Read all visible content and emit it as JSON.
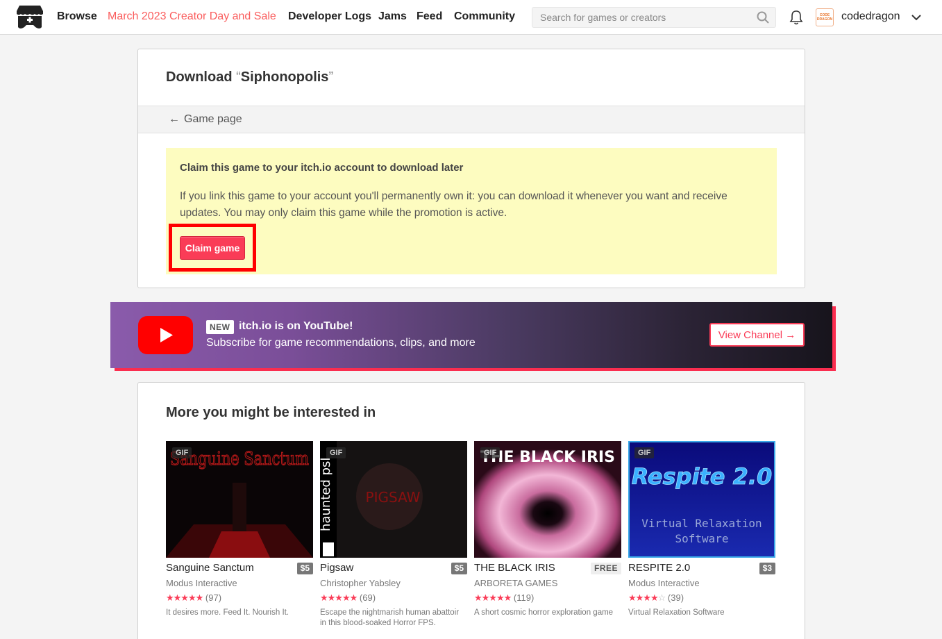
{
  "header": {
    "nav": [
      "Browse",
      "March 2023 Creator Day and Sale",
      "Developer Logs",
      "Jams",
      "Feed",
      "Community"
    ],
    "search_placeholder": "Search for games or creators",
    "username": "codedragon",
    "avatar_text": "CODE DRAGON",
    "accent_color": "#fa5c5c"
  },
  "card": {
    "title_prefix": "Download ",
    "open_quote": "“",
    "game_name": "Siphonopolis",
    "close_quote": "”",
    "back_arrow": "←",
    "back_label": "Game page",
    "claim_heading": "Claim this game to your itch.io account to download later",
    "claim_text": "If you link this game to your account you'll permanently own it: you can download it whenever you want and receive updates. You may only claim this game while the promotion is active.",
    "claim_button": "Claim game"
  },
  "banner": {
    "new_badge": "NEW",
    "title": "itch.io is on YouTube!",
    "subtitle": "Subscribe for game recommendations, clips, and more",
    "button": "View Channel →"
  },
  "recommendations": {
    "title": "More you might be interested in",
    "gif_badge": "GIF",
    "games": [
      {
        "title": "Sanguine Sanctum",
        "price": "$5",
        "author": "Modus Interactive",
        "rating": 4.5,
        "stars": "★★★★★",
        "empty_stars": "",
        "reviews": "(97)",
        "description": "It desires more. Feed It. Nourish It.",
        "thumb_text": "Sanguine Sanctum"
      },
      {
        "title": "Pigsaw",
        "price": "$5",
        "author": "Christopher Yabsley",
        "rating": 4.5,
        "stars": "★★★★★",
        "empty_stars": "",
        "reviews": "(69)",
        "description": "Escape the nightmarish human abattoir in this blood-soaked Horror FPS.",
        "thumb_text": "PIGSAW",
        "thumb_side_text": "haunted psl"
      },
      {
        "title": "THE BLACK IRIS",
        "price": "FREE",
        "author": "ARBORETA GAMES",
        "rating": 4.5,
        "stars": "★★★★★",
        "empty_stars": "",
        "reviews": "(119)",
        "description": "A short cosmic horror exploration game",
        "thumb_text": "THE BLACK IRIS"
      },
      {
        "title": "RESPITE 2.0",
        "price": "$3",
        "author": "Modus Interactive",
        "rating": 4.0,
        "stars": "★★★★",
        "empty_stars": "☆",
        "reviews": "(39)",
        "description": "Virtual Relaxation Software",
        "thumb_text": "Respite 2.0",
        "thumb_sub_1": "Virtual Relaxation",
        "thumb_sub_2": "Software"
      }
    ]
  }
}
